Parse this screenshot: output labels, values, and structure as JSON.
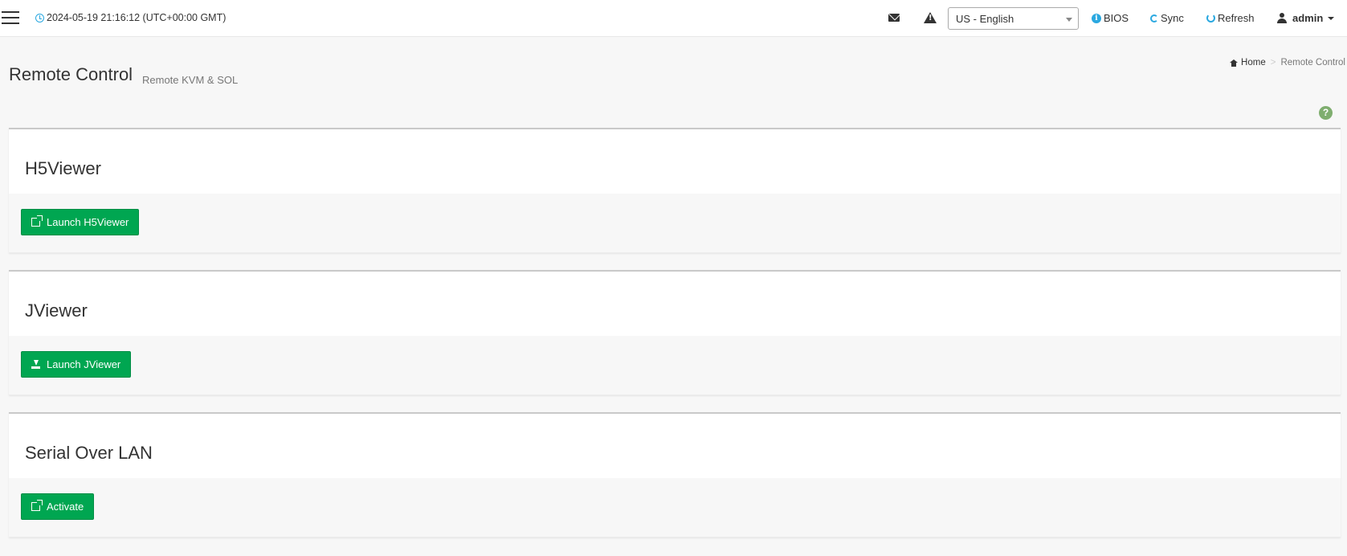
{
  "topbar": {
    "datetime": "2024-05-19 21:16:12 (UTC+00:00 GMT)",
    "language": "US - English",
    "bios_label": "BIOS",
    "sync_label": "Sync",
    "refresh_label": "Refresh",
    "user_label": "admin"
  },
  "page": {
    "title": "Remote Control",
    "subtitle": "Remote KVM & SOL"
  },
  "breadcrumb": {
    "home": "Home",
    "separator": ">",
    "current": "Remote Control"
  },
  "help": "?",
  "sections": [
    {
      "title": "H5Viewer",
      "button": "Launch H5Viewer",
      "icon": "external-link-icon"
    },
    {
      "title": "JViewer",
      "button": "Launch JViewer",
      "icon": "download-icon"
    },
    {
      "title": "Serial Over LAN",
      "button": "Activate",
      "icon": "external-link-icon"
    }
  ],
  "colors": {
    "accent_green": "#00a651",
    "info_blue": "#2aa8e0",
    "help_green": "#7fae6f"
  }
}
